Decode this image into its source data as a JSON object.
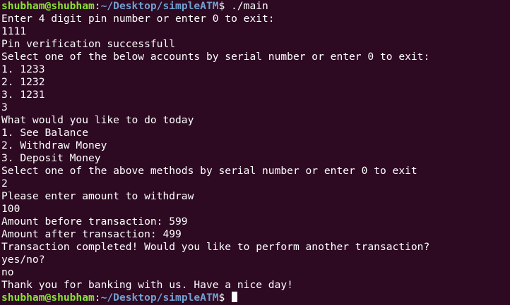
{
  "prompt": {
    "user_host": "shubham@shubham",
    "separator": ":",
    "path": "~/Desktop/simpleATM",
    "symbol": "$",
    "command": " ./main"
  },
  "output_lines": [
    "Enter 4 digit pin number or enter 0 to exit:",
    "1111",
    "Pin verification successfull",
    "Select one of the below accounts by serial number or enter 0 to exit:",
    "1. 1233",
    "2. 1232",
    "3. 1231",
    "3",
    "What would you like to do today",
    "1. See Balance",
    "2. Withdraw Money",
    "3. Deposit Money",
    "Select one of the above methods by serial number or enter 0 to exit",
    "2",
    "Please enter amount to withdraw",
    "100",
    "Amount before transaction: 599",
    "Amount after transaction: 499",
    "Transaction completed! Would you like to perform another transaction?",
    "yes/no?",
    "no",
    "Thank you for banking with us. Have a nice day!"
  ],
  "colors": {
    "background": "#2d0922",
    "text": "#ffffff",
    "user_host": "#8ae234",
    "path": "#729fcf"
  }
}
